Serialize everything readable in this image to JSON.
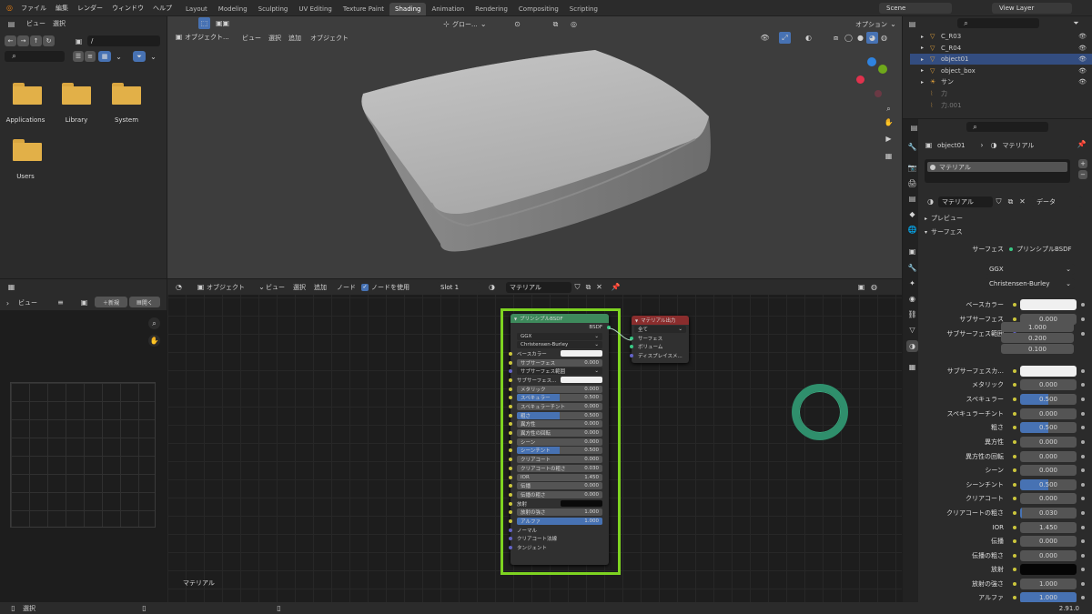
{
  "topbar": {
    "menus": [
      "ファイル",
      "編集",
      "レンダー",
      "ウィンドウ",
      "ヘルプ"
    ],
    "tabs": [
      "Layout",
      "Modeling",
      "Sculpting",
      "UV Editing",
      "Texture Paint",
      "Shading",
      "Animation",
      "Rendering",
      "Compositing",
      "Scripting"
    ],
    "active_tab": "Shading",
    "scene": "Scene",
    "view_layer": "View Layer"
  },
  "filebrowser": {
    "menus": [
      "ビュー",
      "選択"
    ],
    "path": "/",
    "items": [
      "Applications",
      "Library",
      "System",
      "Users"
    ]
  },
  "viewport": {
    "mode": "オブジェクト...",
    "menus": [
      "ビュー",
      "選択",
      "追加",
      "オブジェクト"
    ],
    "orientation": "グロー...",
    "options": "オプション",
    "colors": {
      "object": "#b4b4b4",
      "background": "#3d3d3d"
    }
  },
  "image_editor": {
    "menus": [
      "ビュー"
    ],
    "new_label": "新規",
    "open_label": "開く"
  },
  "node_editor": {
    "mode": "オブジェクト",
    "menus": [
      "ビュー",
      "選択",
      "追加",
      "ノード"
    ],
    "use_nodes": "ノードを使用",
    "slot": "Slot 1",
    "material": "マテリアル",
    "footer_label": "マテリアル",
    "bsdf": {
      "title": "プリンシプルBSDF",
      "output": "BSDF",
      "dist": "GGX",
      "sss": "Christensen-Burley",
      "rows": [
        [
          "ベースカラー",
          ""
        ],
        [
          "サブサーフェス",
          "0.000"
        ],
        [
          "サブサーフェス範囲",
          ""
        ],
        [
          "サブサーフェス...",
          ""
        ],
        [
          "メタリック",
          "0.000"
        ],
        [
          "スペキュラー",
          "0.500"
        ],
        [
          "スペキュラーチント",
          "0.000"
        ],
        [
          "粗さ",
          "0.500"
        ],
        [
          "異方性",
          "0.000"
        ],
        [
          "異方性の回転",
          "0.000"
        ],
        [
          "シーン",
          "0.000"
        ],
        [
          "シーンチント",
          "0.500"
        ],
        [
          "クリアコート",
          "0.000"
        ],
        [
          "クリアコートの粗さ",
          "0.030"
        ],
        [
          "IOR",
          "1.450"
        ],
        [
          "伝播",
          "0.000"
        ],
        [
          "伝播の粗さ",
          "0.000"
        ],
        [
          "放射",
          ""
        ],
        [
          "放射の強さ",
          "1.000"
        ],
        [
          "アルファ",
          "1.000"
        ],
        [
          "ノーマル",
          ""
        ],
        [
          "クリアコート法線",
          ""
        ],
        [
          "タンジェント",
          ""
        ]
      ]
    },
    "output": {
      "title": "マテリアル出力",
      "target": "全て",
      "sockets": [
        "サーフェス",
        "ボリューム",
        "ディスプレイスメ..."
      ]
    },
    "highlight_color": "#7ed321"
  },
  "outliner": {
    "items": [
      "C_R03",
      "C_R04",
      "object01",
      "object_box",
      "サン",
      "力",
      "力.001"
    ],
    "selected": "object01"
  },
  "properties": {
    "object": "object01",
    "tab": "マテリアル",
    "slot": "マテリアル",
    "material_name": "マテリアル",
    "data": "データ",
    "sections": [
      "プレビュー",
      "サーフェス"
    ],
    "surface_label": "サーフェス",
    "surface_value": "プリンシプルBSDF",
    "dist": "GGX",
    "sss": "Christensen-Burley",
    "sss_radius": [
      "1.000",
      "0.200",
      "0.100"
    ],
    "rows": [
      [
        "ベースカラー",
        "",
        ""
      ],
      [
        "サブサーフェス",
        "0.000",
        ""
      ],
      [
        "サブサーフェス範囲",
        "",
        ""
      ],
      [
        "サブサーフェスカ...",
        "",
        ""
      ],
      [
        "メタリック",
        "0.000",
        ""
      ],
      [
        "スペキュラー",
        "0.500",
        "0.5"
      ],
      [
        "スペキュラーチント",
        "0.000",
        ""
      ],
      [
        "粗さ",
        "0.500",
        "0.5"
      ],
      [
        "異方性",
        "0.000",
        ""
      ],
      [
        "異方性の回転",
        "0.000",
        ""
      ],
      [
        "シーン",
        "0.000",
        ""
      ],
      [
        "シーンチント",
        "0.500",
        "0.5"
      ],
      [
        "クリアコート",
        "0.000",
        ""
      ],
      [
        "クリアコートの粗さ",
        "0.030",
        "0.03"
      ],
      [
        "IOR",
        "1.450",
        ""
      ],
      [
        "伝播",
        "0.000",
        ""
      ],
      [
        "伝播の粗さ",
        "0.000",
        ""
      ],
      [
        "放射",
        "",
        ""
      ],
      [
        "放射の強さ",
        "1.000",
        ""
      ],
      [
        "アルファ",
        "1.000",
        "1"
      ]
    ]
  },
  "statusbar": {
    "left": "選択",
    "version": "2.91.0"
  }
}
